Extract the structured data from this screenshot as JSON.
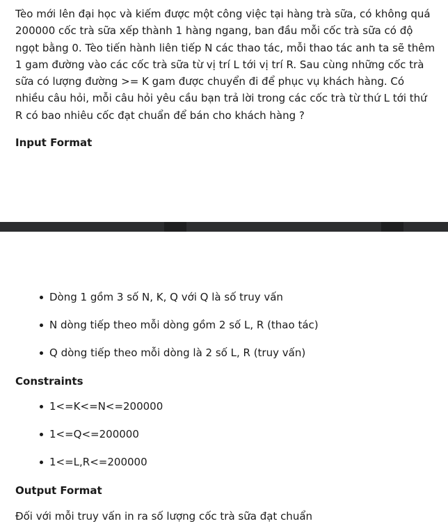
{
  "intro": "Tèo mới lên đại học và kiếm được một công việc tại hàng trà sữa, có không quá 200000 cốc trà sữa xếp thành 1 hàng ngang, ban đầu mỗi cốc trà sữa có độ ngọt bằng 0. Tèo tiến hành liên tiếp N các thao tác, mỗi thao tác anh ta sẽ thêm 1 gam đường vào các cốc trà sữa từ vị trí L tới vị trí R. Sau cùng những cốc trà sữa có lượng đường >= K gam được chuyển đi để phục vụ khách hàng. Có nhiều câu hỏi, mỗi câu hỏi yêu cầu bạn trả lời trong các cốc trà từ thứ L tới thứ R có bao nhiêu cốc đạt chuẩn để bán cho khách hàng ?",
  "input_format": {
    "heading": "Input Format",
    "items": [
      "Dòng 1 gồm 3 số N, K, Q với Q là số truy vấn",
      "N dòng tiếp theo mỗi dòng gồm 2 số L, R (thao tác)",
      "Q dòng tiếp theo mỗi dòng là 2 số L, R (truy vấn)"
    ]
  },
  "constraints": {
    "heading": "Constraints",
    "items": [
      "1<=K<=N<=200000",
      "1<=Q<=200000",
      "1<=L,R<=200000"
    ]
  },
  "output_format": {
    "heading": "Output Format",
    "text": "Đối với mỗi truy vấn in ra số lượng cốc trà sữa đạt chuẩn"
  },
  "colors": {
    "text": "#1a1a1a",
    "divider": "#2a2b2d",
    "background": "#ffffff"
  }
}
